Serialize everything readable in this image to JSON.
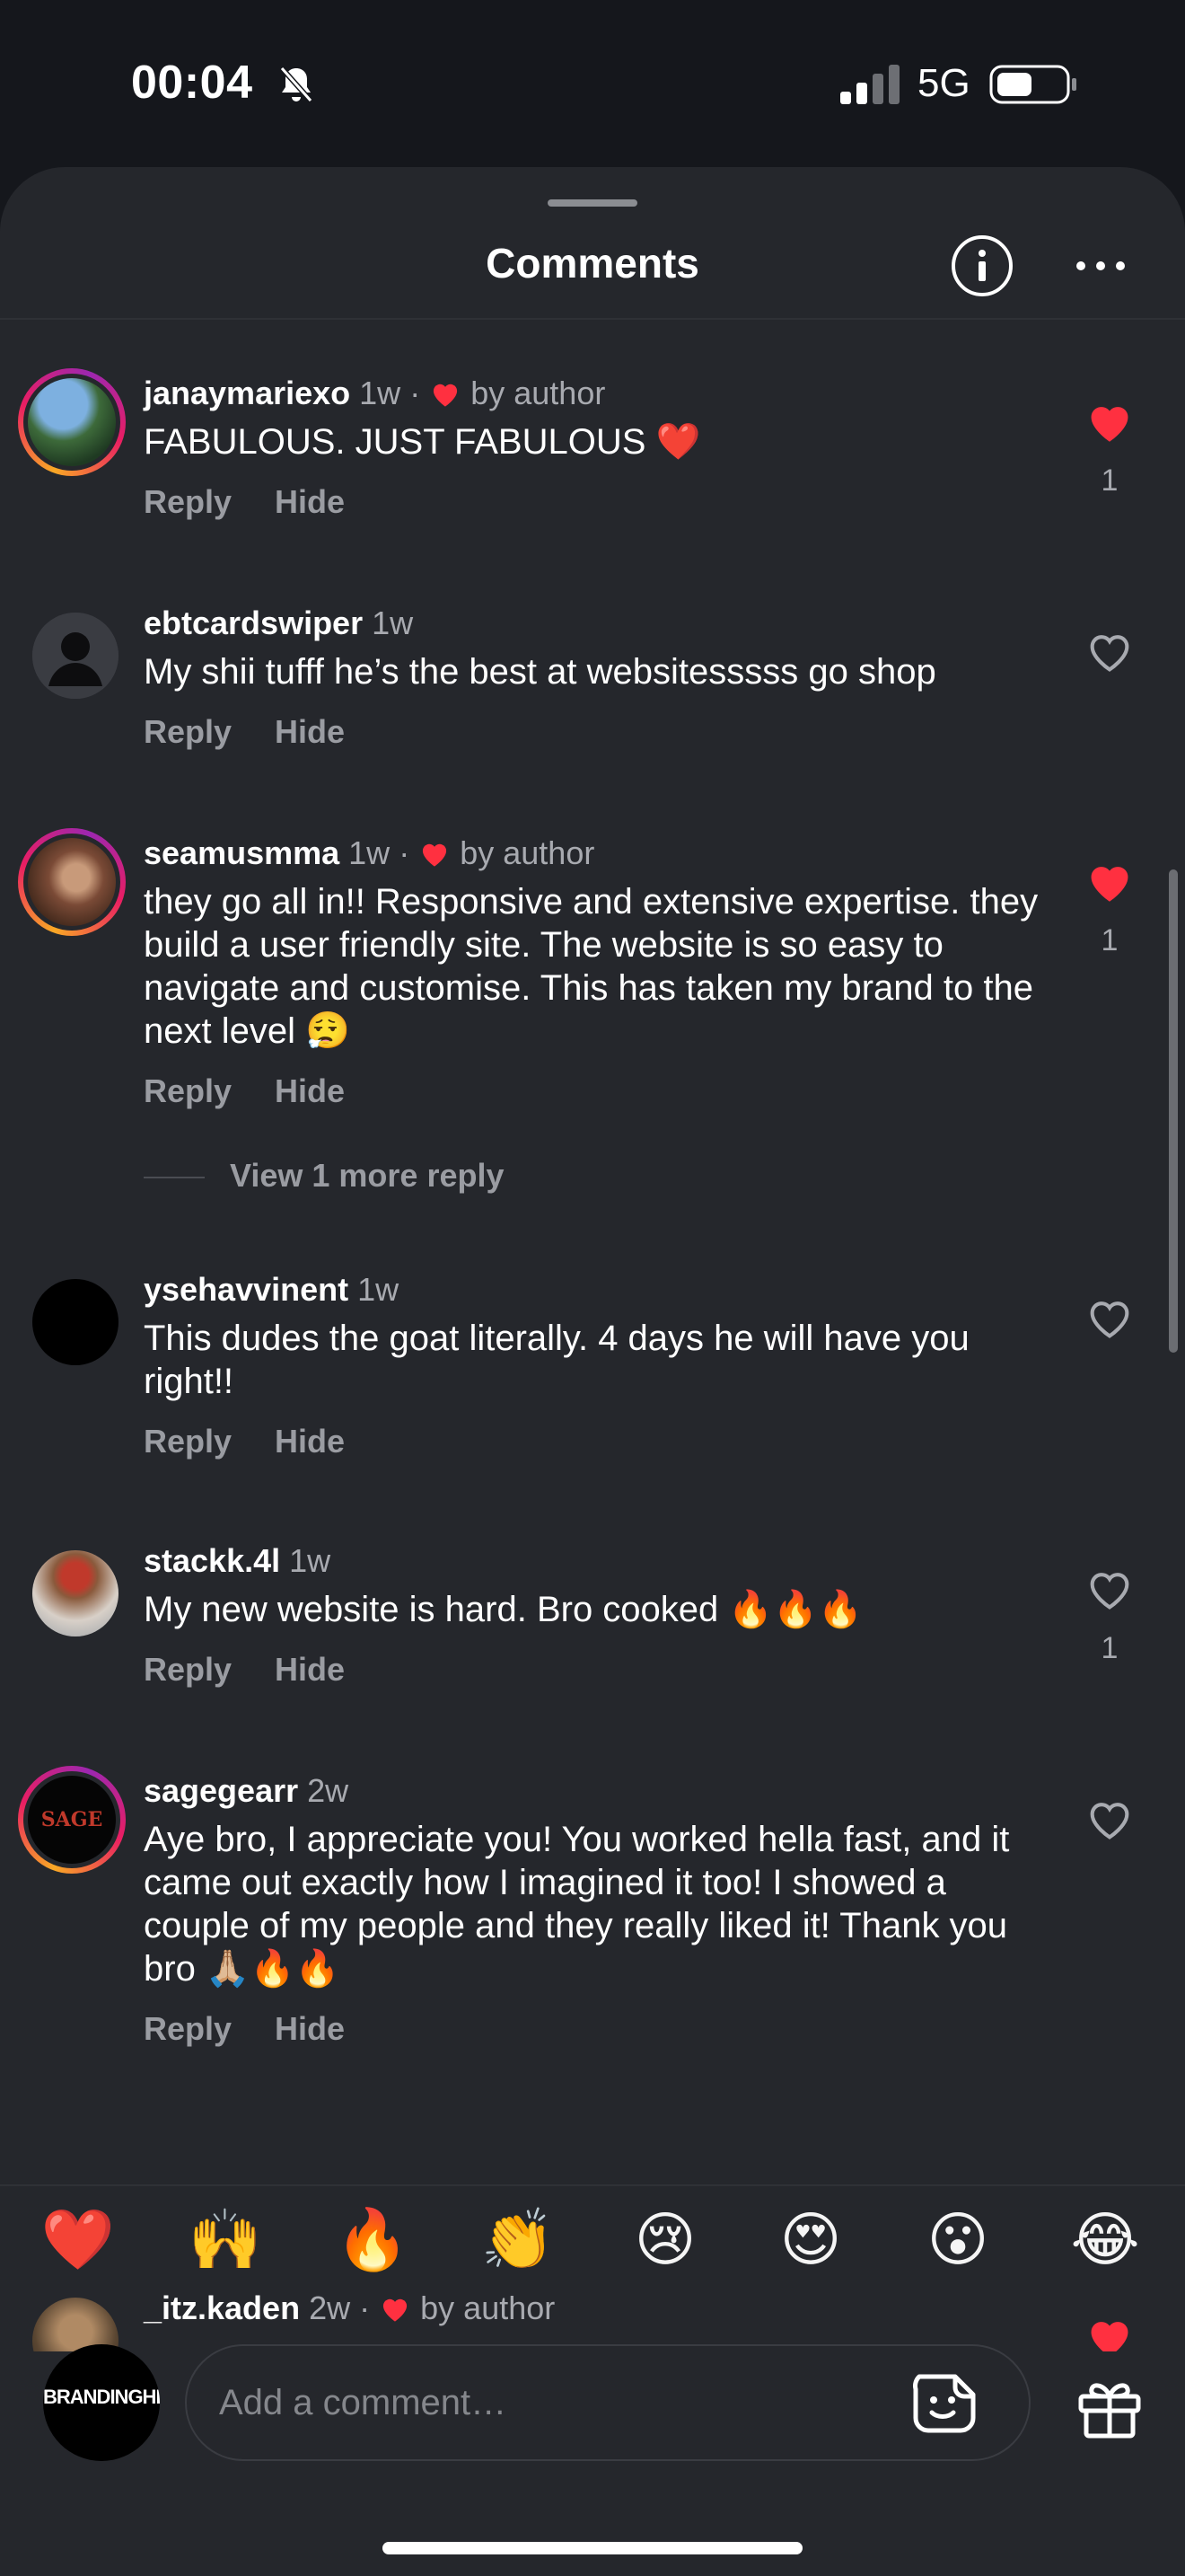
{
  "status_bar": {
    "time": "00:04",
    "network": "5G"
  },
  "header": {
    "title": "Comments",
    "info_icon": "info-icon",
    "more_icon": "ellipsis-icon"
  },
  "actions_labels": {
    "reply": "Reply",
    "hide": "Hide"
  },
  "comments": [
    {
      "username": "janaymariexo",
      "age": "1w",
      "liked_by_author": true,
      "author_label": "by author",
      "text": "FABULOUS. JUST FABULOUS ❤️",
      "liked": true,
      "like_count": "1",
      "avatar_ring": true
    },
    {
      "username": "ebtcardswiper",
      "age": "1w",
      "liked_by_author": false,
      "text": "My shii tufff he’s the best at websitesssss go shop",
      "liked": false,
      "like_count": "",
      "avatar_ring": false
    },
    {
      "username": "seamusmma",
      "age": "1w",
      "liked_by_author": true,
      "author_label": "by author",
      "text": "they go all in!! Responsive and extensive expertise. they build a user friendly site. The website is so easy to navigate and customise. This has taken my brand to the next level 😮‍💨",
      "liked": true,
      "like_count": "1",
      "avatar_ring": true,
      "view_replies": "View 1 more reply"
    },
    {
      "username": "ysehavvinent",
      "age": "1w",
      "liked_by_author": false,
      "text": "This dudes the goat literally. 4 days he will have you right!!",
      "liked": false,
      "like_count": "",
      "avatar_ring": false
    },
    {
      "username": "stackk.4l",
      "age": "1w",
      "liked_by_author": false,
      "text": "My new website is hard. Bro cooked 🔥🔥🔥",
      "liked": false,
      "like_count": "1",
      "avatar_ring": false
    },
    {
      "username": "sagegearr",
      "age": "2w",
      "liked_by_author": false,
      "text": "Aye bro, I appreciate you! You worked hella fast, and it came out exactly how I imagined it too! I showed a couple of my people and they really liked it! Thank you bro 🙏🏼🔥🔥",
      "liked": false,
      "like_count": "",
      "avatar_ring": true,
      "avatar_text": "SAGE"
    },
    {
      "username": "_itz.kaden",
      "age": "2w",
      "liked_by_author": true,
      "author_label": "by author",
      "text": "",
      "liked": true,
      "like_count": "",
      "avatar_ring": false
    }
  ],
  "emoji_bar": [
    "❤️",
    "🙌",
    "🔥",
    "👏",
    "😢",
    "😍",
    "😮",
    "😂"
  ],
  "composer": {
    "avatar_text": "BRANDINGHEAVEN",
    "placeholder": "Add a comment…",
    "sticker_icon": "sticker-icon",
    "gift_icon": "gift-icon"
  },
  "colors": {
    "background": "#25272c",
    "like_red": "#ff3040",
    "muted_text": "#a8aab0"
  }
}
